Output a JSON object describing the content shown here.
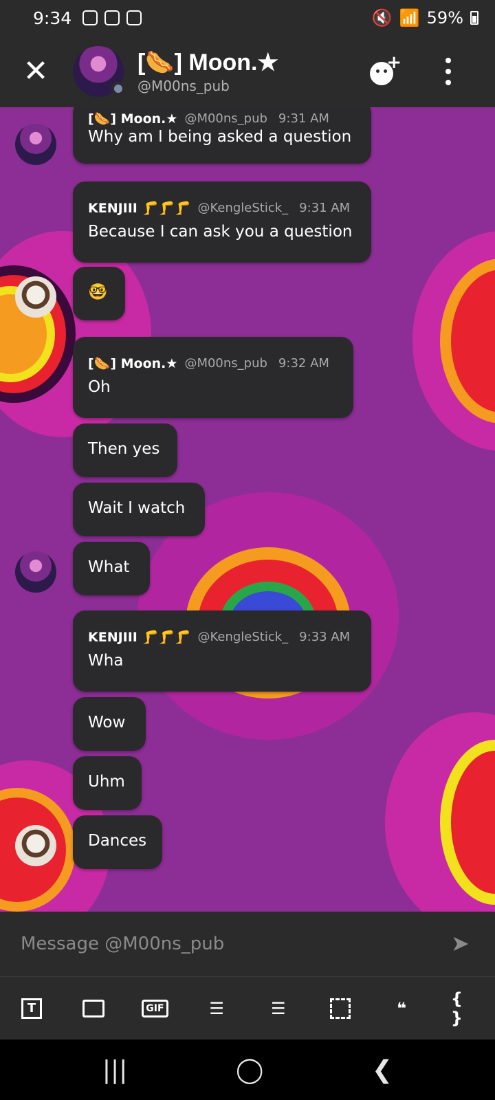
{
  "status_bar": {
    "time": "9:34",
    "battery": "59%"
  },
  "header": {
    "close_icon": "close-icon",
    "title": "[🌭] Moon.★",
    "subtitle": "@M00ns_pub"
  },
  "messages": [
    {
      "name": "[🌭] Moon.★",
      "handle": "@M00ns_pub",
      "time": "9:31 AM",
      "text": "Why am I being asked a question"
    },
    {
      "name": "KENJIII 🦵🦵🦵",
      "handle": "@KengleStick_",
      "time": "9:31 AM",
      "text": "Because I can ask you a question"
    },
    {
      "text": "🤓"
    },
    {
      "name": "[🌭] Moon.★",
      "handle": "@M00ns_pub",
      "time": "9:32 AM",
      "text": "Oh"
    },
    {
      "text": "Then yes"
    },
    {
      "text": "Wait I watch"
    },
    {
      "text": "What"
    },
    {
      "name": "KENJIII 🦵🦵🦵",
      "handle": "@KengleStick_",
      "time": "9:33 AM",
      "text": "Wha"
    },
    {
      "text": "Wow"
    },
    {
      "text": "Uhm"
    },
    {
      "text": "Dances"
    }
  ],
  "composer": {
    "placeholder": "Message @M00ns_pub"
  },
  "toolbar": {
    "gif_label": "GIF",
    "quote_label": "66",
    "code_label": "{ }"
  },
  "colors": {
    "background": "#8d2d96",
    "bubble": "#2a2a2c",
    "bar": "#2b2b2b"
  }
}
